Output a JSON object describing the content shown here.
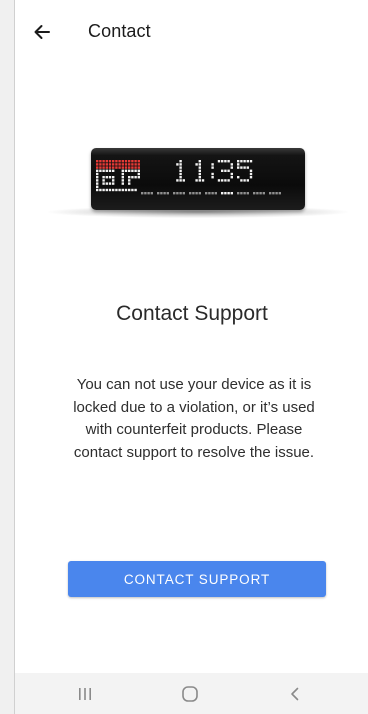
{
  "header": {
    "title": "Contact",
    "back_icon": "arrow-left-icon"
  },
  "device_display": {
    "time": "11:35",
    "icon_accent_color": "#e53935",
    "pixel_color": "#f2f2f2"
  },
  "support": {
    "title": "Contact Support",
    "message": "You can not use your device as it is locked due to a violation, or it’s used with counterfeit products. Please contact support to resolve the issue."
  },
  "button": {
    "label": "CONTACT SUPPORT",
    "color": "#4a86ed"
  },
  "nav": {
    "recents_icon": "recents-icon",
    "home_icon": "home-icon",
    "back_icon": "back-chevron-icon"
  }
}
